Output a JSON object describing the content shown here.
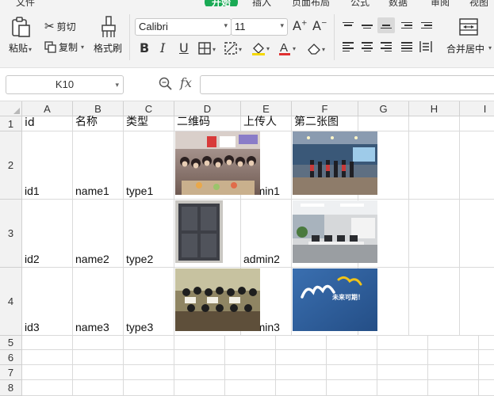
{
  "menu": [
    "文件",
    "开始",
    "插入",
    "页面布局",
    "公式",
    "数据",
    "审阅",
    "视图"
  ],
  "menu_active": "开始",
  "ribbon": {
    "paste": "粘贴",
    "cut": "剪切",
    "copy": "复制",
    "format_painter": "格式刷",
    "font_name": "Calibri",
    "font_size": "11",
    "merge_center": "合并居中"
  },
  "formula_bar": {
    "name_box": "K10",
    "fx": "fx",
    "formula": ""
  },
  "columns": [
    "A",
    "B",
    "C",
    "D",
    "E",
    "F",
    "G",
    "H",
    "I"
  ],
  "rows": [
    "1",
    "2",
    "3",
    "4",
    "5",
    "6",
    "7",
    "8"
  ],
  "headers": [
    "id",
    "名称",
    "类型",
    "二维码",
    "上传人",
    "第二张图"
  ],
  "records": [
    {
      "id": "id1",
      "name": "name1",
      "type": "type1",
      "uploader": "admin1"
    },
    {
      "id": "id2",
      "name": "name2",
      "type": "type2",
      "uploader": "admin2"
    },
    {
      "id": "id3",
      "name": "name3",
      "type": "type3",
      "uploader": "admin3"
    }
  ],
  "logo_text": "未来可期！",
  "colors": {
    "accent": "#1aaa55",
    "grid": "#dadada",
    "header_bg": "#f2f2f2"
  }
}
